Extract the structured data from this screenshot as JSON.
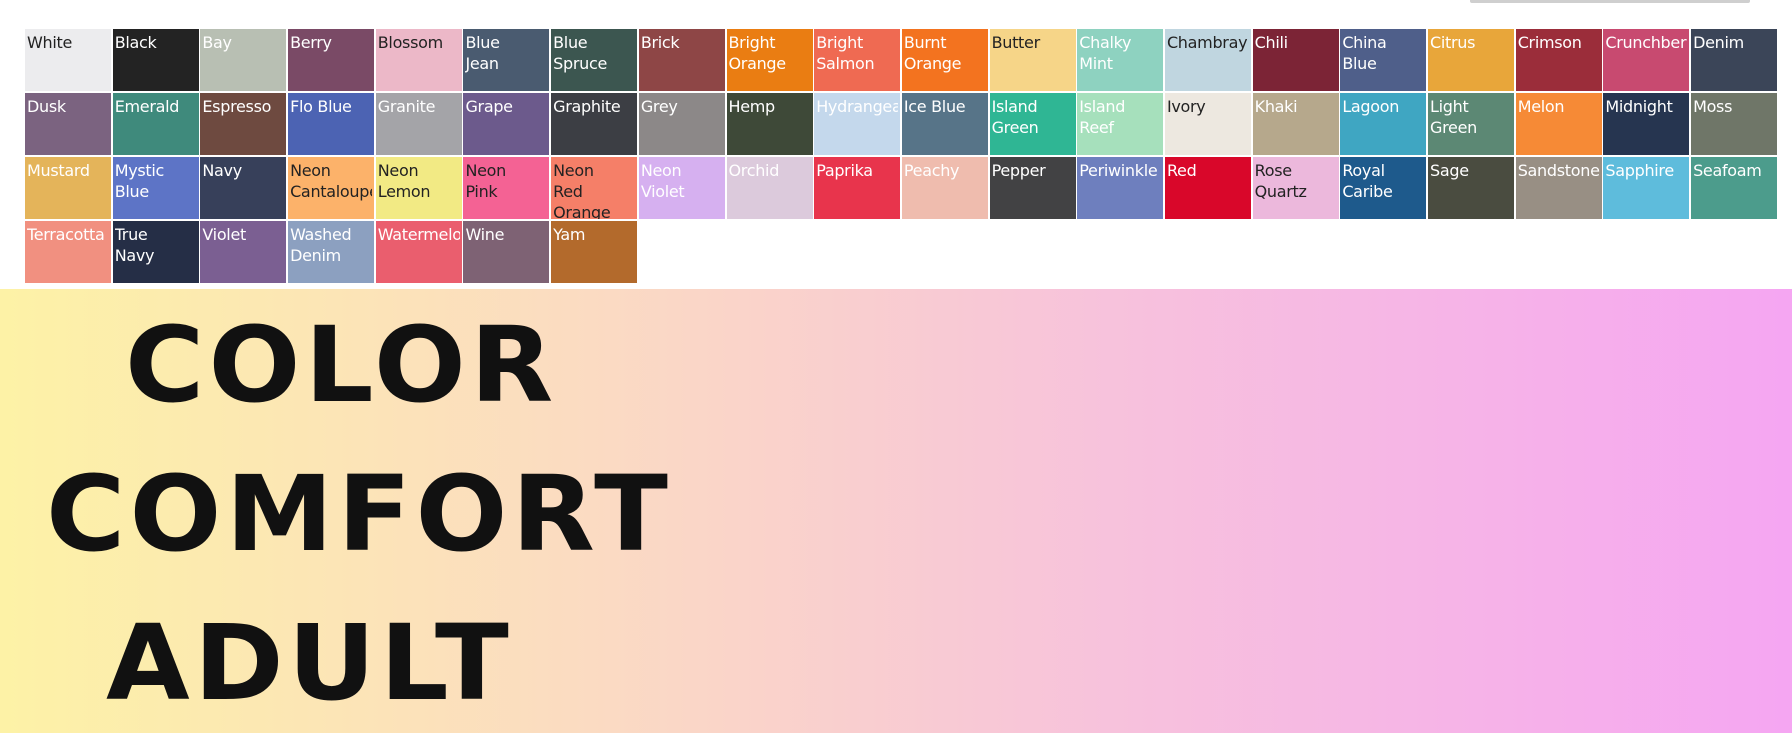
{
  "swatches": [
    {
      "name": "White",
      "color": "#ececee",
      "text": "#222222"
    },
    {
      "name": "Black",
      "color": "#232323",
      "text": "#ffffff"
    },
    {
      "name": "Bay",
      "color": "#b8bfb3",
      "text": "#ffffff"
    },
    {
      "name": "Berry",
      "color": "#7a4a66",
      "text": "#ffffff"
    },
    {
      "name": "Blossom",
      "color": "#ecb8c8",
      "text": "#222222"
    },
    {
      "name": "Blue\nJean",
      "color": "#4a5b70",
      "text": "#ffffff"
    },
    {
      "name": "Blue\nSpruce",
      "color": "#3c5650",
      "text": "#ffffff"
    },
    {
      "name": "Brick",
      "color": "#8e4646",
      "text": "#ffffff"
    },
    {
      "name": "Bright\nOrange",
      "color": "#ea7d12",
      "text": "#ffffff"
    },
    {
      "name": "Bright\nSalmon",
      "color": "#ef6a52",
      "text": "#ffffff"
    },
    {
      "name": "Burnt\nOrange",
      "color": "#f3731f",
      "text": "#ffffff"
    },
    {
      "name": "Butter",
      "color": "#f6d588",
      "text": "#222222"
    },
    {
      "name": "Chalky\nMint",
      "color": "#8ed2c0",
      "text": "#ffffff"
    },
    {
      "name": "Chambray",
      "color": "#c0d6e0",
      "text": "#222222"
    },
    {
      "name": "Chili",
      "color": "#7c2436",
      "text": "#ffffff"
    },
    {
      "name": "China\nBlue",
      "color": "#4f5f8a",
      "text": "#ffffff"
    },
    {
      "name": "Citrus",
      "color": "#e8a63a",
      "text": "#ffffff"
    },
    {
      "name": "Crimson",
      "color": "#9b2d3a",
      "text": "#ffffff"
    },
    {
      "name": "Crunchberry",
      "color": "#c84a70",
      "text": "#ffffff"
    },
    {
      "name": "Denim",
      "color": "#3b4558",
      "text": "#ffffff"
    },
    {
      "name": "Dusk",
      "color": "#7b6380",
      "text": "#ffffff"
    },
    {
      "name": "Emerald",
      "color": "#3f8a7c",
      "text": "#ffffff"
    },
    {
      "name": "Espresso",
      "color": "#6e4a40",
      "text": "#ffffff"
    },
    {
      "name": "Flo Blue",
      "color": "#4c63b3",
      "text": "#ffffff"
    },
    {
      "name": "Granite",
      "color": "#a4a4a8",
      "text": "#ffffff"
    },
    {
      "name": "Grape",
      "color": "#6c5a8c",
      "text": "#ffffff"
    },
    {
      "name": "Graphite",
      "color": "#3c3e44",
      "text": "#ffffff"
    },
    {
      "name": "Grey",
      "color": "#8c8888",
      "text": "#ffffff"
    },
    {
      "name": "Hemp",
      "color": "#3e4938",
      "text": "#ffffff"
    },
    {
      "name": "Hydrangea",
      "color": "#c4d8ec",
      "text": "#ffffff"
    },
    {
      "name": "Ice Blue",
      "color": "#577488",
      "text": "#ffffff"
    },
    {
      "name": "Island\nGreen",
      "color": "#2fb694",
      "text": "#ffffff"
    },
    {
      "name": "Island\nReef",
      "color": "#a6e0bc",
      "text": "#ffffff"
    },
    {
      "name": "Ivory",
      "color": "#ede8e0",
      "text": "#222222"
    },
    {
      "name": "Khaki",
      "color": "#b6a88c",
      "text": "#ffffff"
    },
    {
      "name": "Lagoon",
      "color": "#3fa6c2",
      "text": "#ffffff"
    },
    {
      "name": "Light\nGreen",
      "color": "#5c8874",
      "text": "#ffffff"
    },
    {
      "name": "Melon",
      "color": "#f68a36",
      "text": "#ffffff"
    },
    {
      "name": "Midnight",
      "color": "#263550",
      "text": "#ffffff"
    },
    {
      "name": "Moss",
      "color": "#6f7668",
      "text": "#ffffff"
    },
    {
      "name": "Mustard",
      "color": "#e4b45a",
      "text": "#ffffff"
    },
    {
      "name": "Mystic\nBlue",
      "color": "#5d74c6",
      "text": "#ffffff"
    },
    {
      "name": "Navy",
      "color": "#37405a",
      "text": "#ffffff"
    },
    {
      "name": "Neon\nCantaloupe",
      "color": "#fcb26a",
      "text": "#222222"
    },
    {
      "name": "Neon\nLemon",
      "color": "#f2ea84",
      "text": "#222222"
    },
    {
      "name": "Neon\nPink",
      "color": "#f46294",
      "text": "#222222"
    },
    {
      "name": "Neon\nRed\nOrange",
      "color": "#f57f68",
      "text": "#222222"
    },
    {
      "name": "Neon\nViolet",
      "color": "#d6b0f0",
      "text": "#ffffff"
    },
    {
      "name": "Orchid",
      "color": "#dccadc",
      "text": "#ffffff"
    },
    {
      "name": "Paprika",
      "color": "#e8344c",
      "text": "#ffffff"
    },
    {
      "name": "Peachy",
      "color": "#efbcae",
      "text": "#ffffff"
    },
    {
      "name": "Pepper",
      "color": "#424244",
      "text": "#ffffff"
    },
    {
      "name": "Periwinkle",
      "color": "#6e7fbe",
      "text": "#ffffff"
    },
    {
      "name": "Red",
      "color": "#d9072a",
      "text": "#ffffff"
    },
    {
      "name": "Rose\nQuartz",
      "color": "#ecb8dc",
      "text": "#222222"
    },
    {
      "name": "Royal\nCaribe",
      "color": "#1e5a8c",
      "text": "#ffffff"
    },
    {
      "name": "Sage",
      "color": "#4a4c40",
      "text": "#ffffff"
    },
    {
      "name": "Sandstone",
      "color": "#988f84",
      "text": "#ffffff"
    },
    {
      "name": "Sapphire",
      "color": "#5ebcdc",
      "text": "#ffffff"
    },
    {
      "name": "Seafoam",
      "color": "#4c9c8c",
      "text": "#ffffff"
    },
    {
      "name": "Terracotta",
      "color": "#f19080",
      "text": "#ffffff"
    },
    {
      "name": "True\nNavy",
      "color": "#252e46",
      "text": "#ffffff"
    },
    {
      "name": "Violet",
      "color": "#7b5f92",
      "text": "#ffffff"
    },
    {
      "name": "Washed\nDenim",
      "color": "#8ca0c0",
      "text": "#ffffff"
    },
    {
      "name": "Watermelon",
      "color": "#ea5e6e",
      "text": "#ffffff"
    },
    {
      "name": "Wine",
      "color": "#7e6274",
      "text": "#ffffff"
    },
    {
      "name": "Yam",
      "color": "#b36a2c",
      "text": "#ffffff"
    }
  ],
  "banner": {
    "line1": "COLOR",
    "line2": "COMFORT",
    "line3": "ADULT"
  }
}
